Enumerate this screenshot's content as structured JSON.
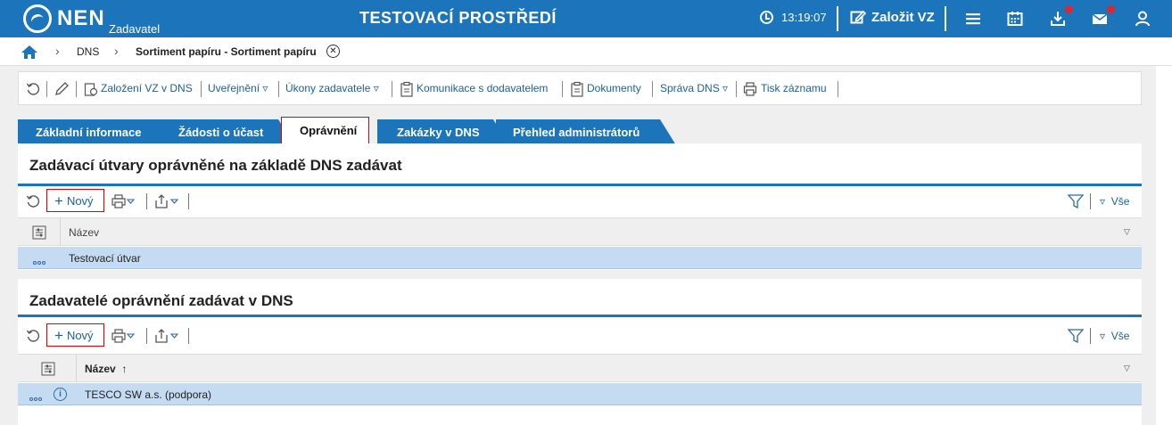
{
  "header": {
    "logo_text": "NEN",
    "logo_sub": "Zadavatel",
    "title": "TESTOVACÍ PROSTŘEDÍ",
    "time": "13:19:07",
    "create_vz": "Založit VZ",
    "icons": [
      "menu-icon",
      "calendar-icon",
      "download-icon",
      "mail-icon",
      "user-icon"
    ],
    "accent": "#1c74bb",
    "alert_color": "#e0252b"
  },
  "breadcrumb": {
    "items": [
      "DNS",
      "Sortiment papíru - Sortiment papíru"
    ]
  },
  "actions": {
    "zalozeni": "Založení VZ v DNS",
    "uverejneni": "Uveřejnění",
    "ukony": "Úkony zadavatele",
    "komunikace": "Komunikace s dodavatelem",
    "dokumenty": "Dokumenty",
    "sprava": "Správa DNS",
    "tisk": "Tisk záznamu",
    "dropdown_glyph": "▿"
  },
  "tabs": [
    {
      "label": "Základní informace"
    },
    {
      "label": "Žádosti o účast"
    },
    {
      "label": "Oprávnění"
    },
    {
      "label": "Zakázky v DNS"
    },
    {
      "label": "Přehled administrátorů"
    }
  ],
  "section1": {
    "title": "Zadávací útvary oprávněné na základě DNS zadávat",
    "new_label": "Nový",
    "all_label": "Vše",
    "column": "Název",
    "rows": [
      {
        "name": "Testovací útvar"
      }
    ]
  },
  "section2": {
    "title": "Zadavatelé oprávnění zadávat v DNS",
    "new_label": "Nový",
    "all_label": "Vše",
    "column": "Název",
    "sort_indicator": "↑",
    "rows": [
      {
        "name": "TESCO SW a.s. (podpora)"
      }
    ]
  }
}
